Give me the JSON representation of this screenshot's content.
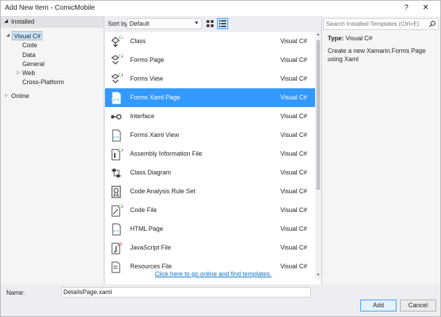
{
  "window": {
    "title": "Add New Item - ComicMobile",
    "help_label": "?",
    "close_label": "✕"
  },
  "left": {
    "installed_label": "Installed",
    "tree": [
      {
        "label": "Visual C#",
        "expanded": true,
        "selected": true
      },
      {
        "label": "Code"
      },
      {
        "label": "Data"
      },
      {
        "label": "General"
      },
      {
        "label": "Web",
        "collapsed": true
      },
      {
        "label": "Cross-Platform"
      }
    ],
    "online_label": "Online"
  },
  "toolbar": {
    "sort_label": "Sort by:",
    "sort_value": "Default"
  },
  "templates": [
    {
      "name": "Class",
      "lang": "Visual C#",
      "icon": "class-icon"
    },
    {
      "name": "Forms Page",
      "lang": "Visual C#",
      "icon": "forms-page-icon"
    },
    {
      "name": "Forms View",
      "lang": "Visual C#",
      "icon": "forms-view-icon"
    },
    {
      "name": "Forms Xaml Page",
      "lang": "Visual C#",
      "icon": "xaml-page-icon",
      "selected": true
    },
    {
      "name": "Interface",
      "lang": "Visual C#",
      "icon": "interface-icon"
    },
    {
      "name": "Forms Xaml View",
      "lang": "Visual C#",
      "icon": "xaml-view-icon"
    },
    {
      "name": "Assembly Information File",
      "lang": "Visual C#",
      "icon": "assembly-info-icon"
    },
    {
      "name": "Class Diagram",
      "lang": "Visual C#",
      "icon": "class-diagram-icon"
    },
    {
      "name": "Code Analysis Rule Set",
      "lang": "Visual C#",
      "icon": "rule-set-icon"
    },
    {
      "name": "Code File",
      "lang": "Visual C#",
      "icon": "code-file-icon"
    },
    {
      "name": "HTML Page",
      "lang": "Visual C#",
      "icon": "html-page-icon"
    },
    {
      "name": "JavaScript File",
      "lang": "Visual C#",
      "icon": "javascript-file-icon"
    },
    {
      "name": "Resources File",
      "lang": "Visual C#",
      "icon": "resources-file-icon"
    }
  ],
  "online_link": "Click here to go online and find templates.",
  "search": {
    "placeholder": "Search Installed Templates (Ctrl+E)"
  },
  "details": {
    "type_label": "Type:",
    "type_value": "Visual C#",
    "description": "Create a new Xamarin.Forms Page using Xaml"
  },
  "bottom": {
    "name_label": "Name:",
    "name_value": "DetailsPage.xaml",
    "add_label": "Add",
    "cancel_label": "Cancel"
  },
  "colors": {
    "selection": "#3399ff",
    "link": "#0e70c0",
    "csharp_green": "#388a34",
    "icon_dark": "#424242",
    "icon_blue": "#1ba1e2"
  }
}
